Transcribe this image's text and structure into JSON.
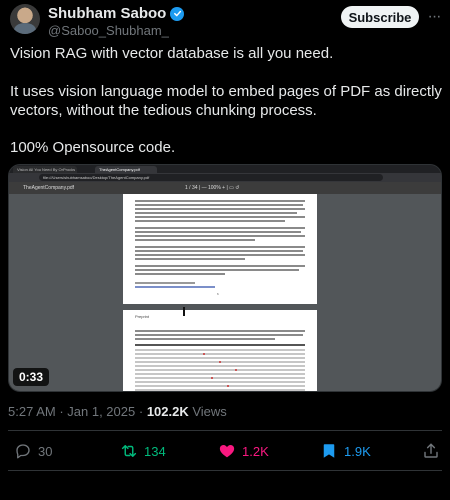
{
  "author": {
    "name": "Shubham Saboo",
    "handle": "@Saboo_Shubham_",
    "subscribe_label": "Subscribe",
    "more_label": "···"
  },
  "tweet": {
    "para1": "Vision RAG with vector database is all you need.",
    "para2": "It uses vision language model to embed pages of PDF as directly vectors, without the tedious chunking process.",
    "para3": "100% Opensource code."
  },
  "media": {
    "browser_tabs": [
      "Vision All You Need By OrProcks",
      "TheAgentCompany.pdf"
    ],
    "url": "file:///Users/shubhamsaboo/Desktop/TheAgentCompany.pdf",
    "pdf_filename": "TheAgentCompany.pdf",
    "pdf_page_controls": "1 / 34  |  —  100%  +  |  ▭  ↺",
    "page2_label": "Preprint",
    "page1_number": "6",
    "video_duration": "0:33"
  },
  "meta": {
    "time": "5:27 AM",
    "date": "Jan 1, 2025",
    "views_count": "102.2K",
    "views_label": "Views"
  },
  "actions": {
    "replies": "30",
    "retweets": "134",
    "likes": "1.2K",
    "bookmarks": "1.9K"
  },
  "colors": {
    "background": "#000000",
    "verified": "#1d9bf0",
    "retweet": "#00ba7c",
    "like": "#f91880",
    "bookmark": "#1d9bf0",
    "muted": "#71767b"
  },
  "icons": {
    "verified": "verified-badge-icon",
    "reply": "reply-icon",
    "retweet": "retweet-icon",
    "like": "heart-icon",
    "bookmark": "bookmark-icon",
    "share": "share-icon"
  }
}
